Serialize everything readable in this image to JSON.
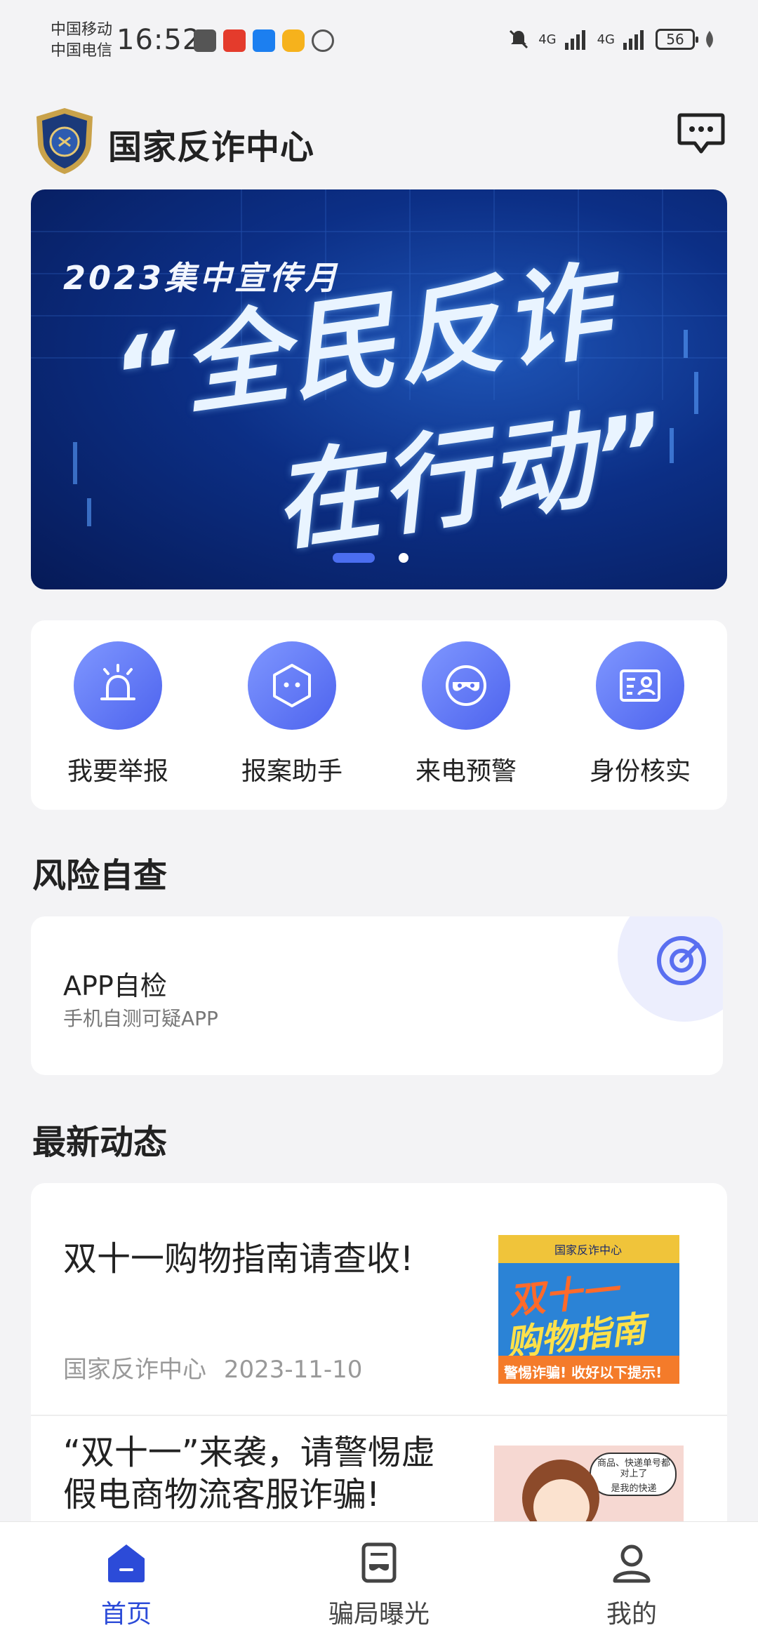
{
  "status_bar": {
    "carrier1": "中国移动",
    "carrier2": "中国电信",
    "time": "16:52",
    "battery": "56",
    "network1": "4G",
    "network2": "4G"
  },
  "header": {
    "title": "国家反诈中心"
  },
  "banner": {
    "subtitle": "2023集中宣传月",
    "line1": "“全民反诈",
    "line2": "在行动”",
    "pages": 2,
    "active_page": 1
  },
  "actions": [
    {
      "label": "我要举报",
      "icon": "alarm-icon"
    },
    {
      "label": "报案助手",
      "icon": "assistant-icon"
    },
    {
      "label": "来电预警",
      "icon": "mask-icon"
    },
    {
      "label": "身份核实",
      "icon": "id-card-icon"
    }
  ],
  "risk_section": {
    "title": "风险自查",
    "card_title": "APP自检",
    "card_subtitle": "手机自测可疑APP"
  },
  "news_section": {
    "title": "最新动态",
    "items": [
      {
        "title": "双十一购物指南请查收!",
        "source": "国家反诈中心",
        "date": "2023-11-10",
        "thumb_text_1": "国家反诈中心",
        "thumb_text_2": "双十一",
        "thumb_text_3": "购物指南",
        "thumb_text_4": "警惕诈骗! 收好以下提示!"
      },
      {
        "title": "“双十一”来袭，请警惕虚假电商物流客服诈骗!",
        "thumb_text_1": "商品、快递单号都对上了",
        "thumb_text_2": "是我的快递"
      }
    ]
  },
  "tabbar": {
    "tabs": [
      {
        "label": "首页",
        "active": true
      },
      {
        "label": "骗局曝光",
        "active": false
      },
      {
        "label": "我的",
        "active": false
      }
    ]
  },
  "colors": {
    "accent": "#4b63ee",
    "tab_active": "#2c4bd8",
    "background": "#f3f3f5"
  }
}
